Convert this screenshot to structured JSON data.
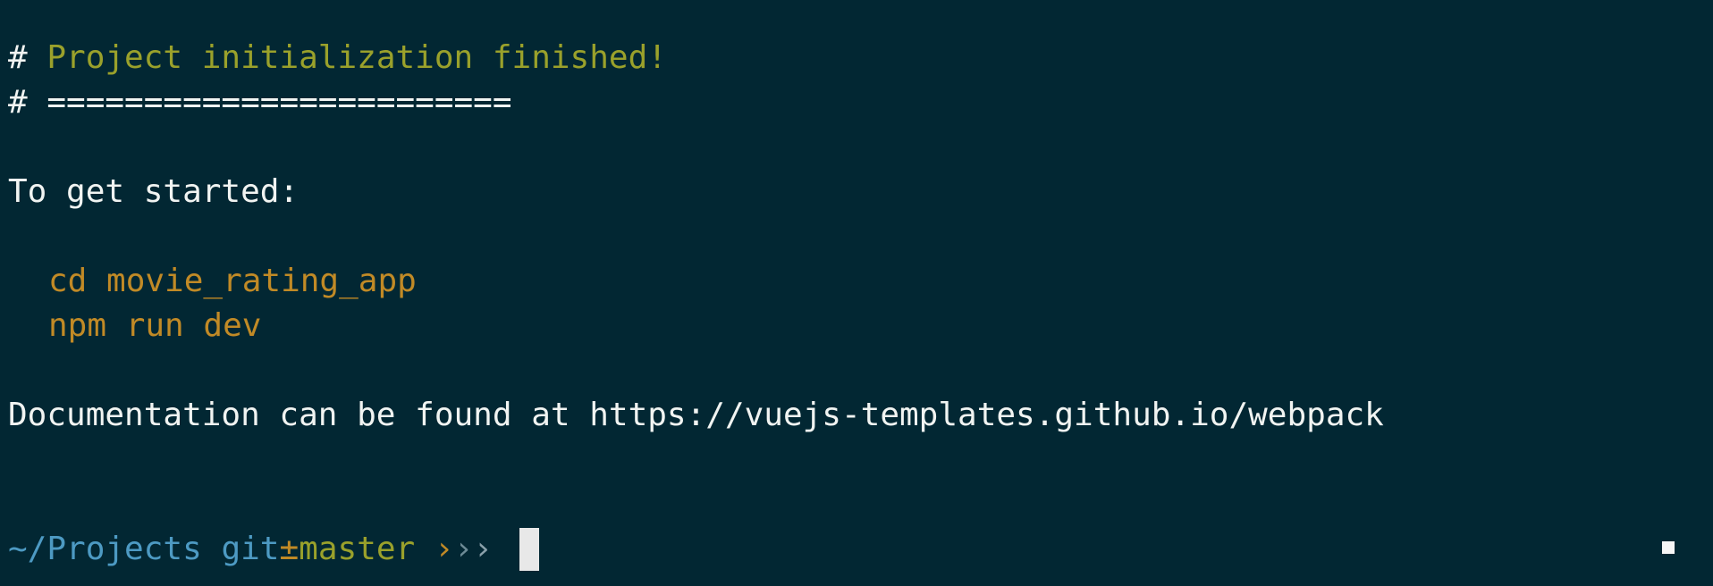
{
  "output": {
    "title_hash": "# ",
    "title_text": "Project initialization finished!",
    "underline_hash": "# ",
    "underline_text": "========================",
    "started_text": "To get started:",
    "commands": [
      "cd movie_rating_app",
      "npm run dev"
    ],
    "documentation_text": "Documentation can be found at https://vuejs-templates.github.io/webpack"
  },
  "prompt": {
    "directory": "~/Projects",
    "git_label": "git",
    "branch_glyph": "±",
    "branch_name": "master",
    "separator_1": "›",
    "separator_2": "›",
    "separator_3": "›"
  },
  "colors": {
    "background": "#022733",
    "foreground": "#f1f4f2",
    "heading": "#9aa12b",
    "command": "#c18a26",
    "prompt_blue": "#4d9ac3"
  }
}
